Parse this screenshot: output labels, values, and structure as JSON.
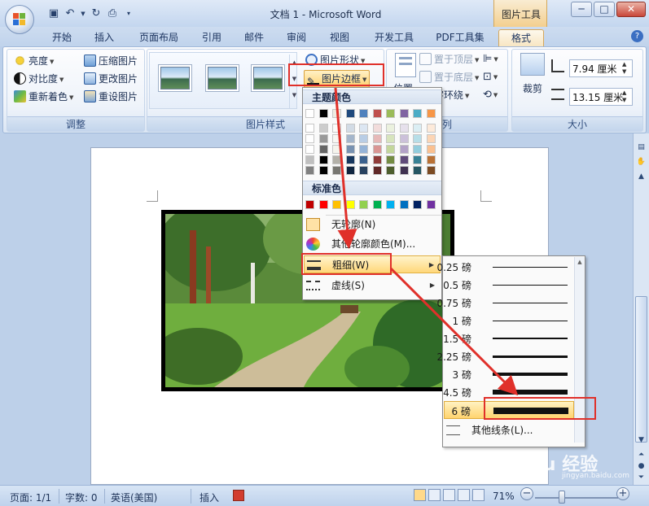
{
  "window": {
    "title": "文档 1 - Microsoft Word",
    "context_tab": "图片工具",
    "controls": {
      "minimize": "─",
      "maximize": "□",
      "close": "✕"
    }
  },
  "tabs": [
    "开始",
    "插入",
    "页面布局",
    "引用",
    "邮件",
    "审阅",
    "视图",
    "开发工具",
    "PDF工具集",
    "格式"
  ],
  "active_tab": "格式",
  "ribbon": {
    "adjust": {
      "label": "调整",
      "items": [
        "亮度",
        "对比度",
        "重新着色",
        "压缩图片",
        "更改图片",
        "重设图片"
      ]
    },
    "picture_styles": {
      "label": "图片样式",
      "shape_button": "图片形状",
      "border_button": "图片边框"
    },
    "arrange": {
      "label": "列",
      "position": "位置",
      "bring_front": "置于顶层",
      "send_back": "置于底层",
      "text_wrap": "字环绕"
    },
    "size": {
      "label": "大小",
      "crop": "裁剪",
      "height": "7.94 厘米",
      "width": "13.15 厘米"
    }
  },
  "border_menu": {
    "theme_colors_header": "主题颜色",
    "standard_colors_header": "标准色",
    "no_outline": "无轮廓(N)",
    "more_colors": "其他轮廓颜色(M)...",
    "weight": "粗细(W)",
    "dashes": "虚线(S)",
    "theme_top_row": [
      "#ffffff",
      "#000000",
      "#eeece1",
      "#1f497d",
      "#4f81bd",
      "#c0504d",
      "#9bbb59",
      "#8064a2",
      "#4bacc6",
      "#f79646"
    ],
    "standard_colors": [
      "#c00000",
      "#ff0000",
      "#ffc000",
      "#ffff00",
      "#92d050",
      "#00b050",
      "#00b0f0",
      "#0070c0",
      "#002060",
      "#7030a0"
    ]
  },
  "weight_menu": {
    "options": [
      "0.25 磅",
      "0.5 磅",
      "0.75 磅",
      "1 磅",
      "1.5 磅",
      "2.25 磅",
      "3 磅",
      "4.5 磅",
      "6 磅"
    ],
    "selected": "6 磅",
    "more_lines": "其他线条(L)..."
  },
  "statusbar": {
    "page": "页面: 1/1",
    "words": "字数: 0",
    "language": "英语(美国)",
    "mode": "插入",
    "zoom": "71%"
  },
  "watermark": {
    "text": "Baidu 经验",
    "sub": "jingyan.baidu.com"
  }
}
